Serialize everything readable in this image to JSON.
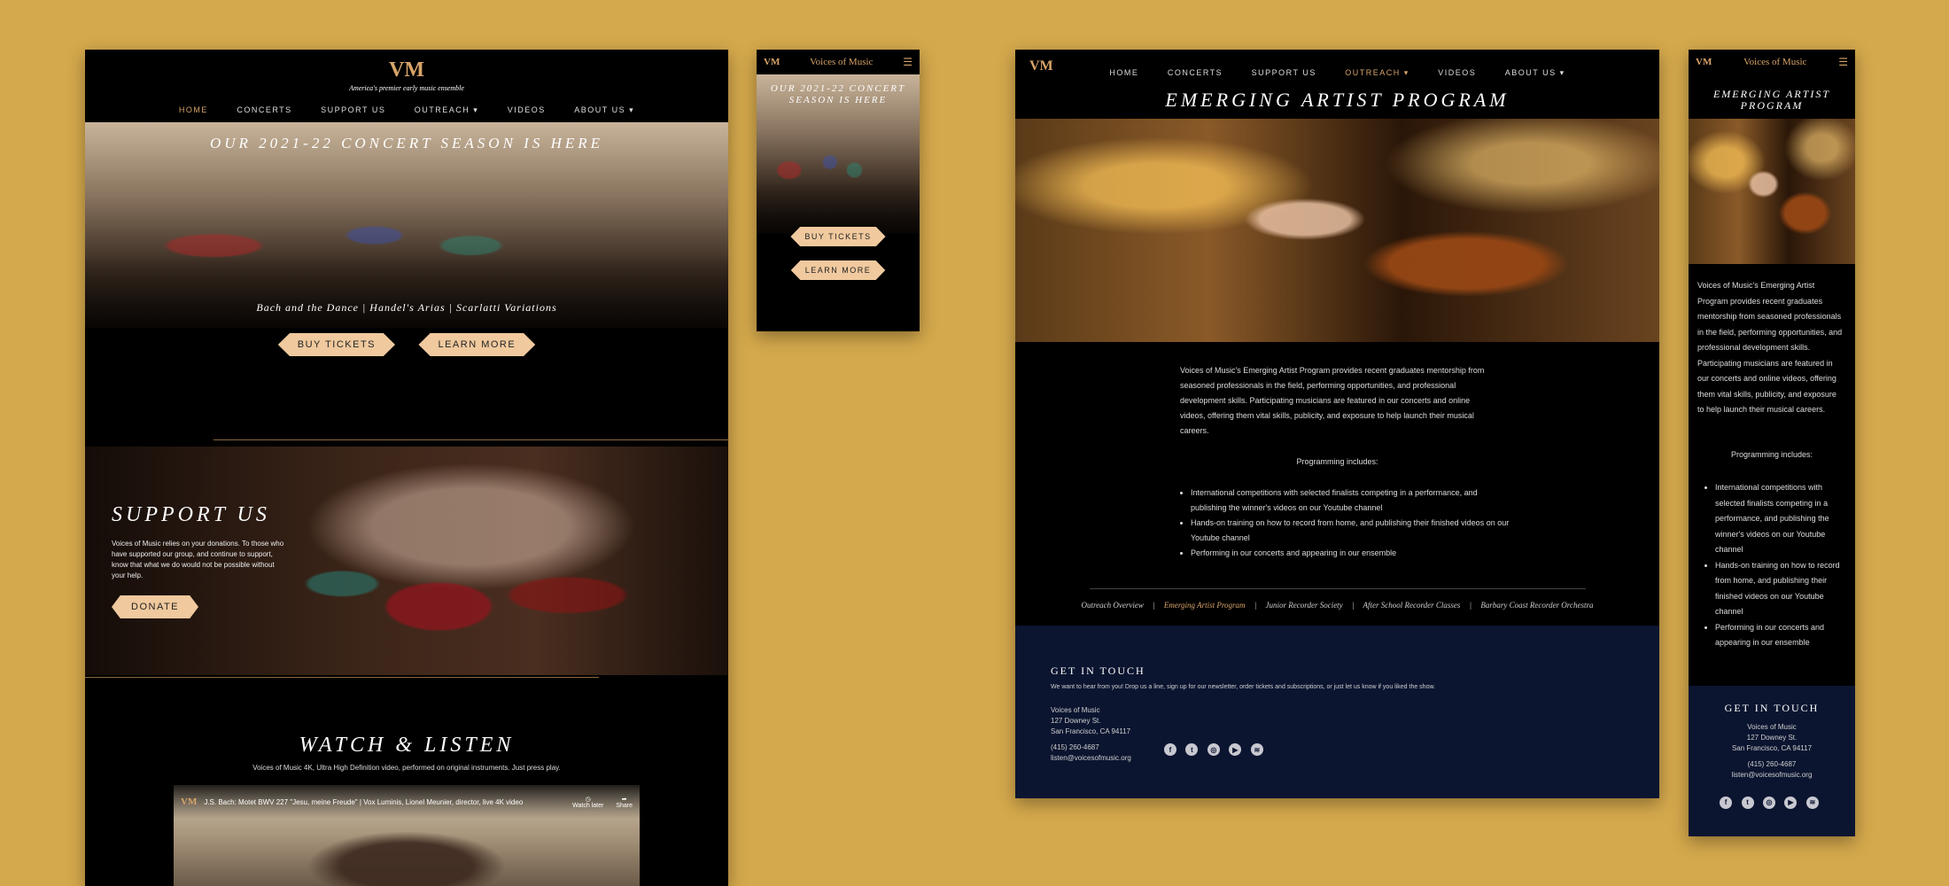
{
  "brand": {
    "logo": "VM",
    "tagline": "America's premier early music ensemble",
    "name": "Voices of Music"
  },
  "nav": {
    "home": "HOME",
    "concerts": "CONCERTS",
    "support": "SUPPORT US",
    "outreach": "OUTREACH ▾",
    "videos": "VIDEOS",
    "about": "ABOUT US ▾"
  },
  "home": {
    "hero_title": "OUR 2021-22 CONCERT SEASON IS HERE",
    "hero_subtitle": "Bach and the Dance | Handel's Arias | Scarlatti Variations",
    "buy_tickets": "BUY TICKETS",
    "learn_more": "LEARN MORE",
    "support_title": "SUPPORT US",
    "support_text": "Voices of Music relies on your donations. To those who have supported our group, and continue to support, know that what we do would not be possible without your help.",
    "donate": "DONATE",
    "watch_title": "WATCH & LISTEN",
    "watch_text": "Voices of Music 4K, Ultra High Definition video, performed on original instruments. Just press play.",
    "video_title": "J.S. Bach: Motet BWV 227 \"Jesu, meine Freude\" | Vox Luminis, Lionel Meunier, director, live 4K video",
    "watch_later": "Watch later",
    "share": "Share"
  },
  "mobile_home": {
    "hero_title": "OUR 2021-22 CONCERT SEASON IS HERE",
    "buy_tickets": "BUY TICKETS",
    "learn_more": "LEARN MORE"
  },
  "eap": {
    "title": "EMERGING ARTIST PROGRAM",
    "intro": "Voices of Music's Emerging Artist Program provides recent graduates mentorship from seasoned professionals in the field, performing opportunities, and professional development skills. Participating musicians are featured in our concerts and online videos, offering them vital skills, publicity, and exposure to help launch their musical careers.",
    "programming_label": "Programming includes:",
    "items": [
      "International competitions with selected finalists competing in a performance, and publishing the winner's videos on our Youtube channel",
      "Hands-on training on how to record from home, and publishing their finished videos on our Youtube channel",
      "Performing in our concerts and appearing in our ensemble"
    ],
    "subnav": [
      "Outreach Overview",
      "Emerging Artist Program",
      "Junior Recorder Society",
      "After School Recorder Classes",
      "Barbary Coast Recorder Orchestra"
    ],
    "subnav_sep": "|"
  },
  "contact": {
    "title": "GET IN TOUCH",
    "text": "We want to hear from you! Drop us a line, sign up for our newsletter, order tickets and subscriptions, or just let us know if you liked the show.",
    "name": "Voices of Music",
    "street": "127 Downey St.",
    "city": "San Francisco, CA 94117",
    "phone": "(415) 260-4687",
    "email": "listen@voicesofmusic.org"
  },
  "social_icons": [
    "facebook-icon",
    "twitter-icon",
    "instagram-icon",
    "youtube-icon",
    "spotify-icon"
  ],
  "colors": {
    "background": "#d4a84c",
    "accent": "#d8a46a",
    "button": "#f0c99e",
    "footer": "#0b1530"
  }
}
